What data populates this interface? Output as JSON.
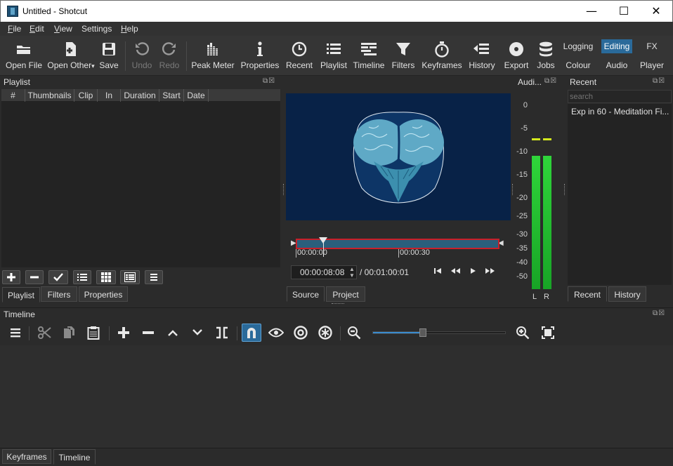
{
  "window": {
    "title": "Untitled - Shotcut",
    "min_glyph": "—",
    "max_glyph": "☐",
    "close_glyph": "✕"
  },
  "menu": [
    {
      "label": "File",
      "u": "F",
      "rest": "ile"
    },
    {
      "label": "Edit",
      "u": "E",
      "rest": "dit"
    },
    {
      "label": "View",
      "u": "V",
      "rest": "iew"
    },
    {
      "label": "Settings",
      "u": "",
      "rest": "Settings"
    },
    {
      "label": "Help",
      "u": "H",
      "rest": "elp"
    }
  ],
  "toolbar": {
    "open_file": "Open File",
    "open_other": "Open Other",
    "open_other_arrow": "▾",
    "save": "Save",
    "undo": "Undo",
    "redo": "Redo",
    "peak_meter": "Peak Meter",
    "properties": "Properties",
    "recent": "Recent",
    "playlist": "Playlist",
    "timeline": "Timeline",
    "filters": "Filters",
    "keyframes": "Keyframes",
    "history": "History",
    "export": "Export",
    "jobs": "Jobs"
  },
  "layouts": {
    "logging": "Logging",
    "editing": "Editing",
    "fx": "FX",
    "colour": "Colour",
    "audio": "Audio",
    "player": "Player"
  },
  "playlist": {
    "title": "Playlist",
    "columns": [
      "#",
      "Thumbnails",
      "Clip",
      "In",
      "Duration",
      "Start",
      "Date"
    ],
    "tabs": [
      "Playlist",
      "Filters",
      "Properties"
    ]
  },
  "player": {
    "scrub_labels": [
      "00:00:00",
      "00:00:30"
    ],
    "current_time": "00:00:08:08",
    "total_time": "/ 00:01:00:01",
    "tabs": [
      "Source",
      "Project"
    ]
  },
  "audio": {
    "title": "Audi...",
    "ticks": [
      "0",
      "-5",
      "-10",
      "-15",
      "-20",
      "-25",
      "-30",
      "-35",
      "-40",
      "-50"
    ],
    "channels": [
      "L",
      "R"
    ],
    "level_left": 0.78,
    "level_right": 0.78,
    "peak_color": "#d4e81e",
    "bar_color": "#2fd53a"
  },
  "recent": {
    "title": "Recent",
    "search_placeholder": "search",
    "items": [
      "Exp in 60 - Meditation Fi..."
    ],
    "tabs": [
      "Recent",
      "History"
    ]
  },
  "timeline": {
    "title": "Timeline",
    "zoom_level": 0.38,
    "bottom_tabs": [
      "Keyframes",
      "Timeline"
    ]
  },
  "colors": {
    "accent": "#2a6a9a",
    "viewer_bg": "#082247",
    "scrub_border": "#c8202a"
  }
}
